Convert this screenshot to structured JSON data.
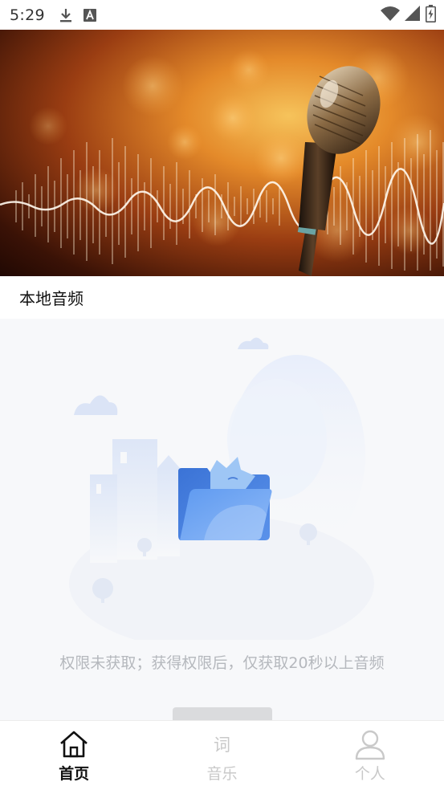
{
  "status_bar": {
    "time": "5:29",
    "left_icons": [
      "download-icon",
      "keyboard-a-icon"
    ],
    "right_icons": [
      "wifi-icon",
      "signal-icon",
      "battery-icon"
    ]
  },
  "banner": {
    "image": "microphone-bokeh-banner",
    "colors": {
      "warm": "#f6c35b",
      "orange": "#e48a2a",
      "dark": "#3a1206"
    }
  },
  "section": {
    "title": "本地音频"
  },
  "empty_state": {
    "illustration": "empty-folder-illustration",
    "message": "权限未获取；获得权限后，仅获取20秒以上音频"
  },
  "bottom_nav": {
    "items": [
      {
        "label": "首页",
        "icon": "home-icon",
        "active": true
      },
      {
        "label": "音乐",
        "icon_glyph": "词",
        "icon": "lyric-icon",
        "active": false
      },
      {
        "label": "个人",
        "icon": "person-icon",
        "active": false
      }
    ]
  },
  "colors": {
    "accent": "#3d7be2",
    "inactive": "#c9c9c9",
    "active": "#111111",
    "empty_text": "#b5b8bd"
  }
}
